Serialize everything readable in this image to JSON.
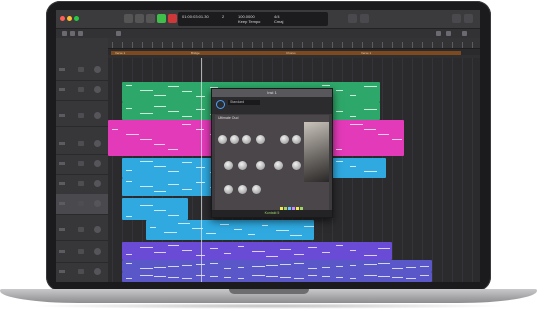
{
  "app": {
    "lcd": {
      "position": "01:00:03:01.30",
      "bar": "2",
      "tempo": "100.0000",
      "signature": "4/4",
      "key": "Cmaj",
      "tempo_label": "Keep Tempo"
    }
  },
  "arrange": {
    "cycle_labels": [
      "Verse 1",
      "Bridge",
      "Chorus",
      "Verse 1"
    ],
    "tracks": [
      {
        "color": "#2ea86a"
      },
      {
        "color": "#2ea86a"
      },
      {
        "color": "#e23ab8"
      },
      {
        "color": "#2fa9e0"
      },
      {
        "color": "#2fa9e0"
      },
      {
        "color": "#2fa9e0"
      },
      {
        "color": "#2fa9e0"
      },
      {
        "color": "#6a4bd6"
      },
      {
        "color": "#5a57c8"
      },
      {
        "color": "#5a57c8"
      }
    ]
  },
  "plugin": {
    "title": "Inst 1",
    "preset": "Standard",
    "instrument": "Ultimate Oud",
    "footer": "Kontakt 5"
  },
  "colors": {
    "green": "#2ea86a",
    "magenta": "#e23ab8",
    "cyan": "#2fa9e0",
    "purple": "#6a4bd6",
    "cycle": "#7c4a1e"
  }
}
